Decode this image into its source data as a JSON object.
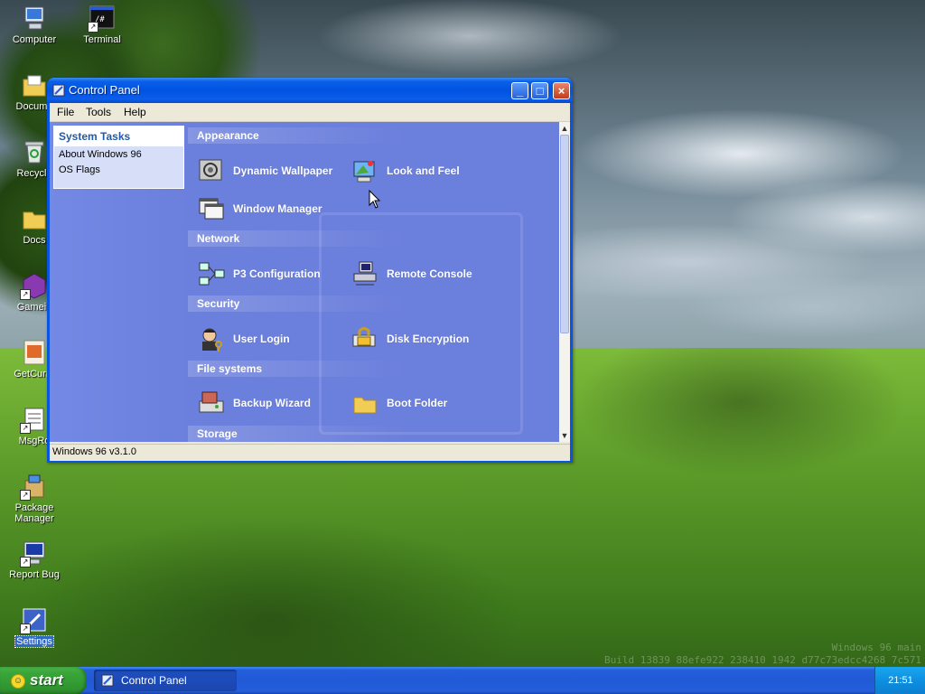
{
  "desktop": {
    "icons": [
      {
        "label": "Computer"
      },
      {
        "label": "Terminal"
      },
      {
        "label": "Docume"
      },
      {
        "label": "Recycle"
      },
      {
        "label": "Docs"
      },
      {
        "label": "Gamein"
      },
      {
        "label": "GetCurre"
      },
      {
        "label": "MsgRo"
      },
      {
        "label": "Package Manager"
      },
      {
        "label": "Report Bug"
      },
      {
        "label": "Settings"
      }
    ],
    "terminal_glyph_text": "/#",
    "watermark_line1": "Windows 96 main",
    "watermark_line2": "Build 13839 88efe922 238410 1942 d77c73edcc4268 7c571"
  },
  "window": {
    "title": "Control Panel",
    "controls": {
      "minimize": "_",
      "maximize": "□",
      "close": "×"
    },
    "menu": [
      "File",
      "Tools",
      "Help"
    ],
    "tasks": {
      "header": "System Tasks",
      "items": [
        "About Windows 96",
        "OS Flags"
      ]
    },
    "sections": [
      {
        "title": "Appearance",
        "items": [
          "Dynamic Wallpaper",
          "Look and Feel",
          "Window Manager"
        ]
      },
      {
        "title": "Network",
        "items": [
          "P3 Configuration",
          "Remote Console"
        ]
      },
      {
        "title": "Security",
        "items": [
          "User Login",
          "Disk Encryption"
        ]
      },
      {
        "title": "File systems",
        "items": [
          "Backup Wizard",
          "Boot Folder"
        ]
      },
      {
        "title": "Storage",
        "items": []
      }
    ],
    "scroll": {
      "up": "▲",
      "down": "▼"
    },
    "status": "Windows 96 v3.1.0"
  },
  "taskbar": {
    "start_label": "start",
    "start_face": "☺",
    "tasks": [
      "Control Panel"
    ],
    "clock": "21:51"
  },
  "colors": {
    "titlebar": "#0053e1",
    "content_bg": "#6b7fdc",
    "taskbar": "#245edb",
    "start": "#3aa63a"
  }
}
